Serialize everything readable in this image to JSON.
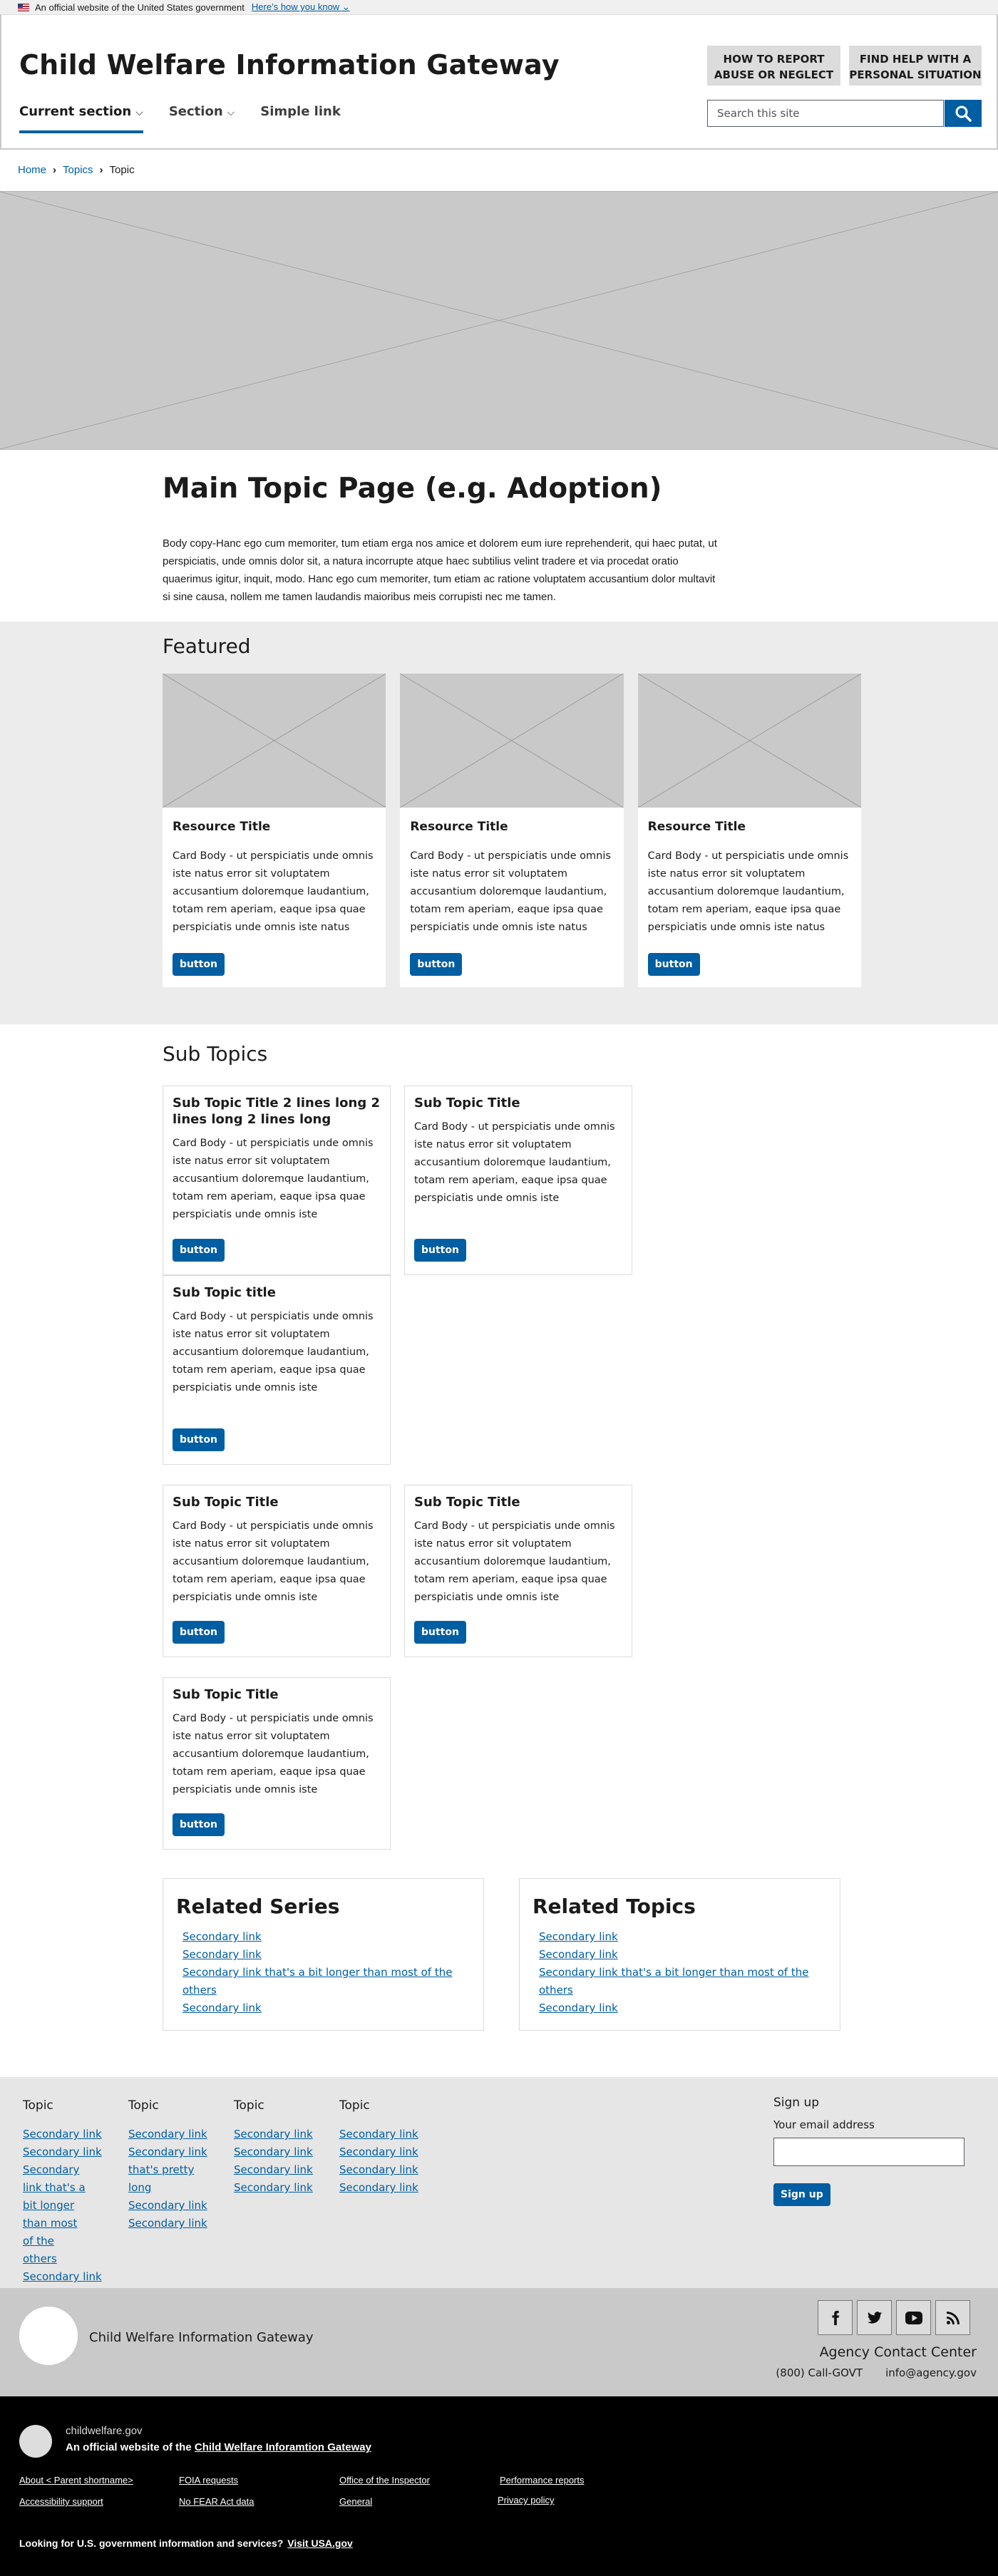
{
  "gov_banner": {
    "text": "An official website of the United States government",
    "link": "Here’s how you know"
  },
  "header": {
    "site_title": "Child Welfare Information Gateway",
    "nav": [
      "Current section",
      "Section",
      "Simple link"
    ],
    "report_button": "HOW TO REPORT ABUSE OR NEGLECT",
    "help_button": "FIND HELP WITH A PERSONAL SITUATION",
    "search_placeholder": "Search this site"
  },
  "breadcrumb": [
    "Home",
    "Topics",
    "Topic"
  ],
  "main": {
    "title": "Main Topic Page (e.g. Adoption)",
    "body": "Body copy-Hanc ego cum memoriter, tum etiam erga nos amice et dolorem eum iure reprehenderit, qui haec putat, ut perspiciatis, unde omnis dolor sit, a natura incorrupte atque haec subtilius velint tradere et via procedat oratio quaerimus igitur, inquit, modo. Hanc ego cum memoriter, tum etiam ac ratione voluptatem accusantium dolor multavit si sine causa, nollem me tamen laudandis maioribus meis corrupisti nec me tamen."
  },
  "featured": {
    "title": "Featured",
    "cards": [
      {
        "title": "Resource Title",
        "body": "Card Body - ut perspiciatis unde omnis iste natus error sit voluptatem accusantium doloremque laudantium, totam rem aperiam, eaque ipsa quae perspiciatis unde omnis iste natus",
        "button": "button"
      },
      {
        "title": "Resource Title",
        "body": "Card Body - ut perspiciatis unde omnis iste natus error sit voluptatem accusantium doloremque laudantium, totam rem aperiam, eaque ipsa quae perspiciatis unde omnis iste natus",
        "button": "button"
      },
      {
        "title": "Resource Title",
        "body": "Card Body - ut perspiciatis unde omnis iste natus error sit voluptatem accusantium doloremque laudantium, totam rem aperiam, eaque ipsa quae perspiciatis unde omnis iste natus",
        "button": "button"
      }
    ]
  },
  "subtopics": {
    "title": "Sub Topics",
    "cards": [
      {
        "title": "Sub Topic Title 2 lines long 2 lines long 2 lines long",
        "body": "Card Body - ut perspiciatis unde omnis iste natus error sit voluptatem accusantium doloremque laudantium, totam rem aperiam, eaque ipsa quae perspiciatis unde omnis iste",
        "button": "button"
      },
      {
        "title": "Sub Topic Title",
        "body": "Card Body - ut perspiciatis unde omnis iste natus error sit voluptatem accusantium doloremque laudantium, totam rem aperiam, eaque ipsa quae perspiciatis unde omnis iste",
        "button": "button"
      },
      {
        "title": "Sub Topic title",
        "body": "Card Body - ut perspiciatis unde omnis iste natus error sit voluptatem accusantium doloremque laudantium, totam rem aperiam, eaque ipsa quae perspiciatis unde omnis iste",
        "button": "button"
      },
      {
        "title": "Sub Topic Title",
        "body": "Card Body - ut perspiciatis unde omnis iste natus error sit voluptatem accusantium doloremque laudantium, totam rem aperiam, eaque ipsa quae perspiciatis unde omnis iste",
        "button": "button"
      },
      {
        "title": "Sub Topic Title",
        "body": "Card Body - ut perspiciatis unde omnis iste natus error sit voluptatem accusantium doloremque laudantium, totam rem aperiam, eaque ipsa quae perspiciatis unde omnis iste",
        "button": "button"
      },
      {
        "title": "Sub Topic Title",
        "body": "Card Body - ut perspiciatis unde omnis iste natus error sit voluptatem accusantium doloremque laudantium, totam rem aperiam, eaque ipsa quae perspiciatis unde omnis iste",
        "button": "button"
      }
    ]
  },
  "related": [
    {
      "title": "Related Series",
      "links": [
        "Secondary link",
        "Secondary link",
        "Secondary link that's a bit longer than most of the others",
        "Secondary link"
      ]
    },
    {
      "title": "Related Topics",
      "links": [
        "Secondary link",
        "Secondary link",
        "Secondary link that's a bit longer than most of the others",
        "Secondary link"
      ]
    }
  ],
  "footer": {
    "columns": [
      {
        "title": "Topic",
        "links": [
          "Secondary link",
          "Secondary link",
          "Secondary link that's a bit longer than most of the others",
          "Secondary link"
        ]
      },
      {
        "title": "Topic",
        "links": [
          "Secondary link",
          "Secondary link that's pretty long",
          "Secondary link",
          "Secondary link"
        ]
      },
      {
        "title": "Topic",
        "links": [
          "Secondary link",
          "Secondary link",
          "Secondary link",
          "Secondary link"
        ]
      },
      {
        "title": "Topic",
        "links": [
          "Secondary link",
          "Secondary link",
          "Secondary link",
          "Secondary link"
        ]
      }
    ],
    "signup": {
      "title": "Sign up",
      "label": "Your email address",
      "button": "Sign up"
    },
    "org_name": "Child Welfare Information Gateway",
    "social_icons": [
      "facebook-icon",
      "twitter-icon",
      "youtube-icon",
      "rss-icon"
    ],
    "contact": {
      "title": "Agency Contact Center",
      "phone": "(800) Call-GOVT",
      "email": "info@agency.gov"
    }
  },
  "identifier": {
    "domain": "childwelfare.gov",
    "official_prefix": "An official website of the",
    "official_link": "Child Welfare Inforamtion Gateway",
    "links": [
      "About < Parent shortname>",
      "FOIA requests",
      "Office of the Inspector",
      "Performance reports",
      "Accessibility support",
      "No FEAR Act data",
      "General",
      "Privacy policy"
    ],
    "usa_text": "Looking for U.S. government information and services?",
    "usa_link": "Visit USA.gov"
  },
  "colors": {
    "primary": "#005ea2",
    "gray_light": "#ececec",
    "gray_mid": "#c9c9c9",
    "black": "#000000"
  }
}
